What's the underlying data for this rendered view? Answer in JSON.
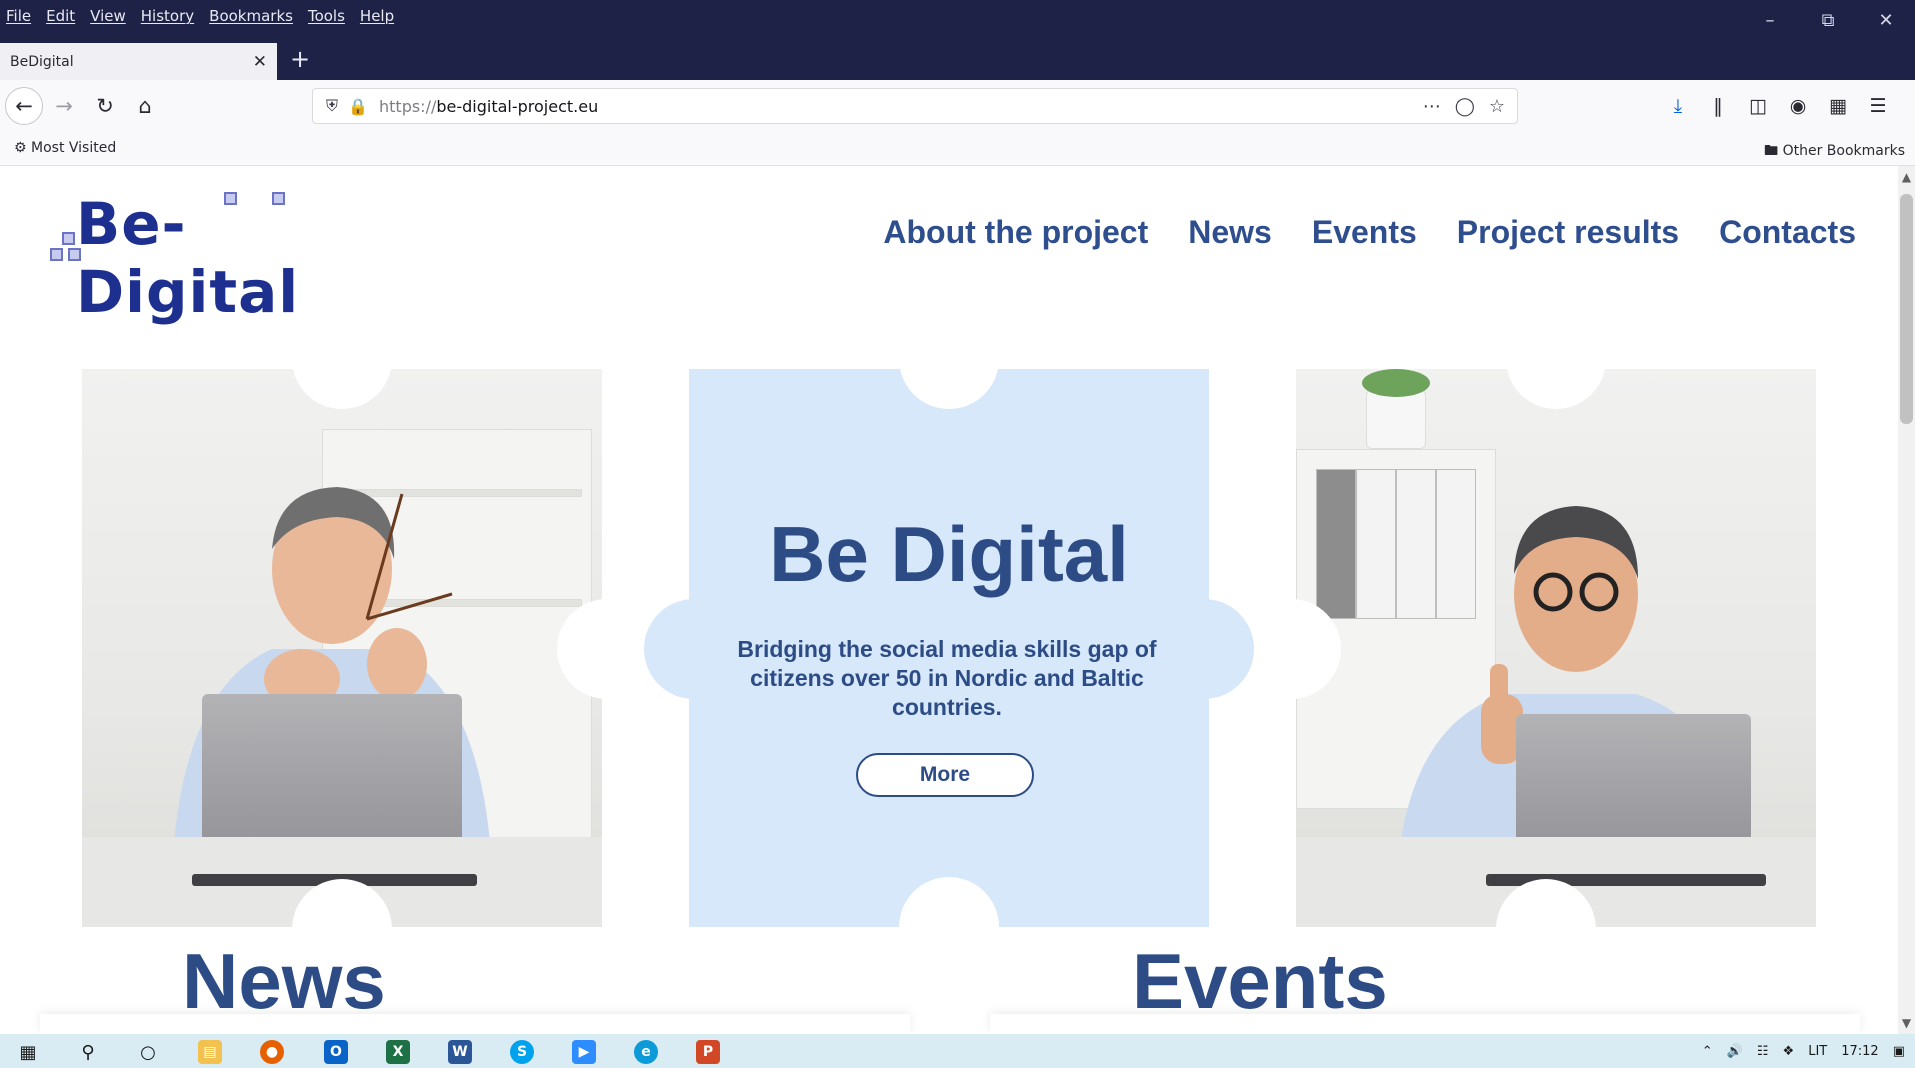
{
  "browser": {
    "menu": [
      "File",
      "Edit",
      "View",
      "History",
      "Bookmarks",
      "Tools",
      "Help"
    ],
    "tab_title": "BeDigital",
    "url_proto": "https://",
    "url_host": "be-digital-project.eu",
    "bookmarks": {
      "most_visited": "Most Visited",
      "other": "Other Bookmarks"
    }
  },
  "site": {
    "logo": "Be-Digital",
    "nav": [
      "About the project",
      "News",
      "Events",
      "Project results",
      "Contacts"
    ],
    "hero": {
      "title": "Be Digital",
      "subtitle": "Bridging the social media skills gap of citizens over 50 in Nordic and Baltic countries.",
      "button": "More"
    },
    "sections": {
      "news": "News",
      "events": "Events"
    }
  },
  "taskbar": {
    "tray_lang": "LIT",
    "clock": "17:12"
  },
  "colors": {
    "brand_blue": "#2d4c86",
    "logo_blue": "#1d2f8f",
    "hero_bg": "#d6e8fa",
    "chrome_dark": "#1f2247"
  }
}
